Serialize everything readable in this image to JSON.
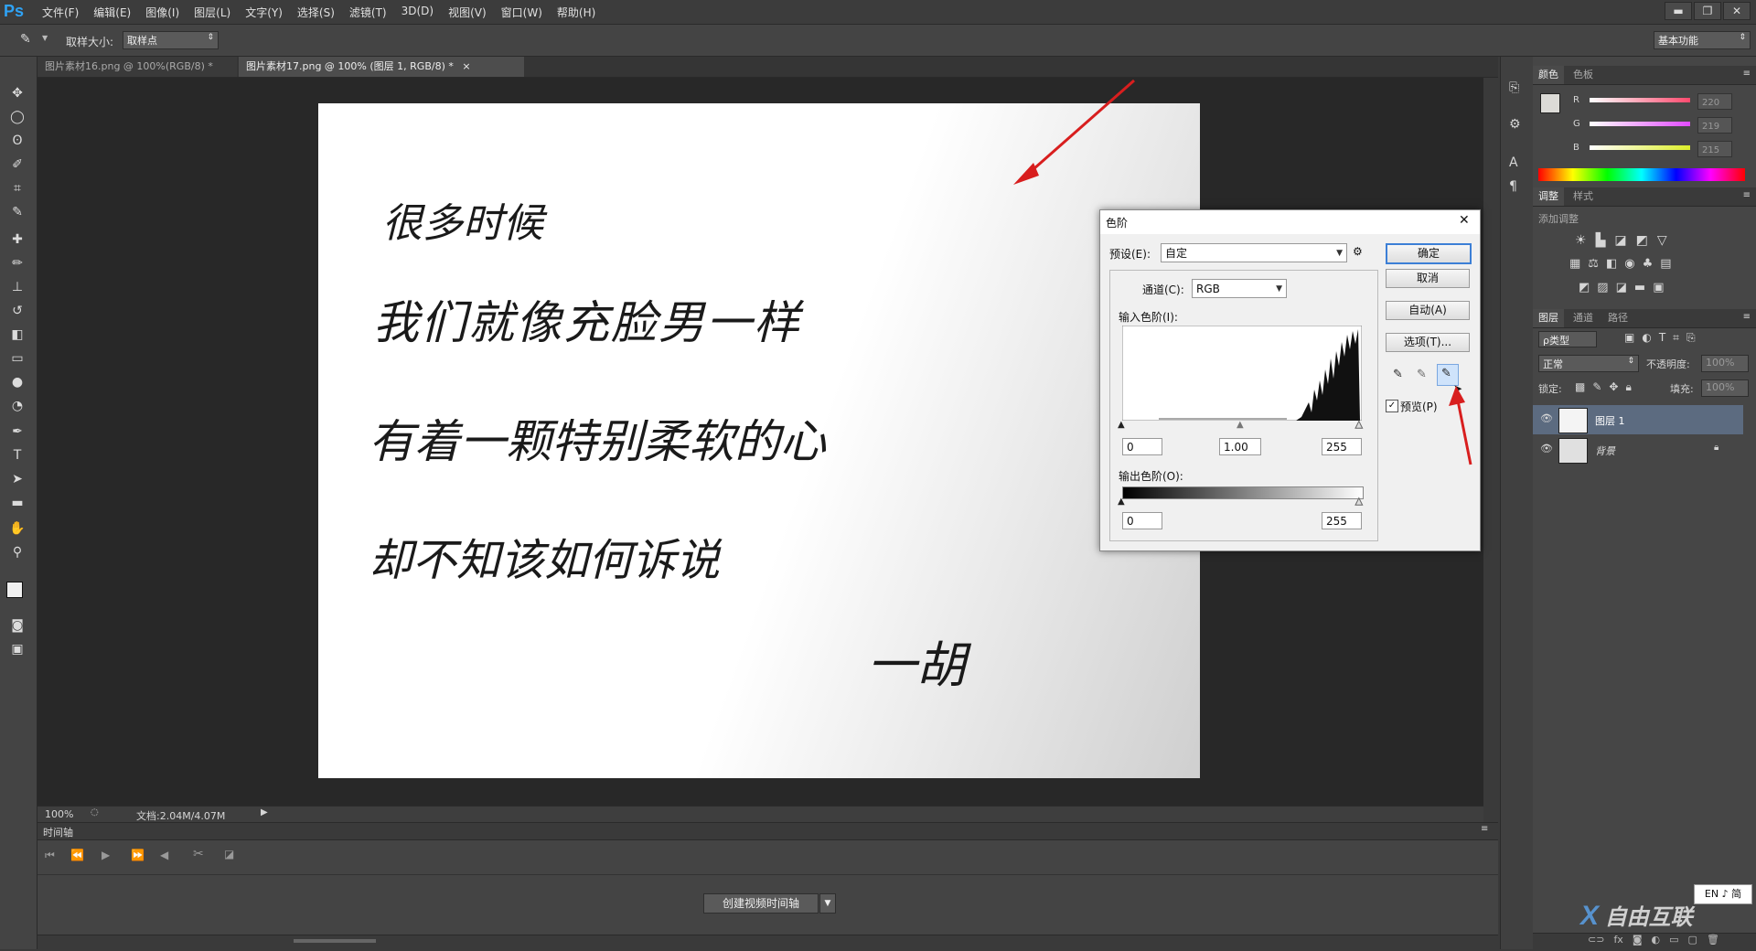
{
  "app": {
    "logo": "Ps"
  },
  "menu": [
    "文件(F)",
    "编辑(E)",
    "图像(I)",
    "图层(L)",
    "文字(Y)",
    "选择(S)",
    "滤镜(T)",
    "3D(D)",
    "视图(V)",
    "窗口(W)",
    "帮助(H)"
  ],
  "window_controls": {
    "minimize": "▬",
    "restore": "❐",
    "close": "✕"
  },
  "options": {
    "sample_size_label": "取样大小:",
    "sample_size_value": "取样点",
    "workspace": "基本功能"
  },
  "tabs": [
    {
      "label": "图片素材16.png @ 100%(RGB/8) *",
      "close": "×"
    },
    {
      "label": "图片素材17.png @ 100% (图层 1, RGB/8) *",
      "close": "×"
    }
  ],
  "document": {
    "lines": [
      "很多时候",
      "我们就像充脸男一样",
      "有着一颗特别柔软的心",
      "却不知该如何诉说"
    ],
    "signature": "一胡"
  },
  "status": {
    "zoom": "100%",
    "doc_info": "文档:2.04M/4.07M"
  },
  "timeline": {
    "title": "时间轴",
    "create_button": "创建视频时间轴"
  },
  "color_panel": {
    "tabs": [
      "颜色",
      "色板"
    ],
    "channels": [
      {
        "label": "R",
        "value": "220"
      },
      {
        "label": "G",
        "value": "219"
      },
      {
        "label": "B",
        "value": "215"
      }
    ],
    "colors": {
      "r_bar": "#ff4a6e",
      "g_bar": "#e14bff",
      "b_bar": "#dcee2a"
    }
  },
  "adjust_panel": {
    "tabs": [
      "调整",
      "样式"
    ],
    "subtitle": "添加调整"
  },
  "layers_panel": {
    "tabs": [
      "图层",
      "通道",
      "路径"
    ],
    "kind_label": "ρ类型",
    "blend_mode": "正常",
    "opacity_label": "不透明度:",
    "opacity_value": "100%",
    "lock_label": "锁定:",
    "fill_label": "填充:",
    "fill_value": "100%",
    "layers": [
      {
        "name": "图层 1",
        "selected": true
      },
      {
        "name": "背景",
        "selected": false
      }
    ]
  },
  "levels_dialog": {
    "title": "色阶",
    "preset_label": "预设(E):",
    "preset_value": "自定",
    "channel_label": "通道(C):",
    "channel_value": "RGB",
    "input_label": "输入色阶(I):",
    "input_values": [
      "0",
      "1.00",
      "255"
    ],
    "output_label": "输出色阶(O):",
    "output_values": [
      "0",
      "255"
    ],
    "buttons": {
      "ok": "确定",
      "cancel": "取消",
      "auto": "自动(A)",
      "options": "选项(T)..."
    },
    "preview_label": "预览(P)",
    "preview_checked": true,
    "close": "✕"
  },
  "ime": {
    "label": "EN ♪ 简"
  },
  "watermark": {
    "text": "自由互联"
  }
}
